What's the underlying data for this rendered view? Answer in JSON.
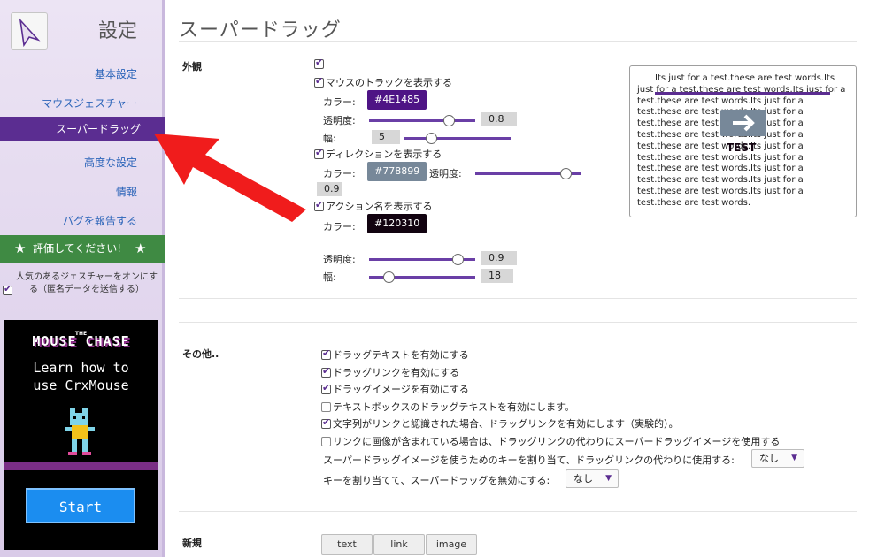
{
  "sidebar": {
    "title": "設定",
    "nav": [
      {
        "label": "基本設定"
      },
      {
        "label": "マウスジェスチャー"
      },
      {
        "label": "スーパードラッグ",
        "active": true
      },
      {
        "label": "高度な設定"
      },
      {
        "label": "情報"
      },
      {
        "label": "バグを報告する"
      }
    ],
    "rate_label": "評価してください!",
    "stats_label": "人気のあるジェスチャーをオンにする（匿名データを送信する）",
    "ad": {
      "the": "THE",
      "title": "MOUSE CHASE",
      "tagline_1": "Learn how to",
      "tagline_2": "use CrxMouse",
      "start": "Start"
    }
  },
  "main": {
    "title": "スーパードラッグ",
    "appearance": {
      "label": "外観",
      "show_track": "マウスのトラックを表示する",
      "color_label": "カラー:",
      "track_color": "#4E1485",
      "opacity_label": "透明度:",
      "track_opacity": "0.8",
      "width_label": "幅:",
      "track_width": "5",
      "show_direction": "ディレクションを表示する",
      "direction_color": "#778899",
      "direction_opacity": "0.9",
      "show_action": "アクション名を表示する",
      "action_color": "#120310",
      "action_opacity": "0.9",
      "action_width": "18"
    },
    "preview": {
      "text": "Its just for a test.these are test words.Its just for a test.these are test words.Its just for a test.these are test words.Its just for a test.these are test words.Its just for a test.these are test words.Its just for a test.these are test words.Its just for a test.these are test words.Its just for a test.these are test words.Its just for a test.these are test words.Its just for a test.these are test words.Its just for a test.these are test words.Its just for a test.these are test words.",
      "action_label": "TEST"
    },
    "other": {
      "label": "その他..",
      "options": [
        {
          "label": "ドラッグテキストを有効にする",
          "checked": true
        },
        {
          "label": "ドラッグリンクを有効にする",
          "checked": true
        },
        {
          "label": "ドラッグイメージを有効にする",
          "checked": true
        },
        {
          "label": "テキストボックスのドラッグテキストを有効にします。",
          "checked": false
        },
        {
          "label": "文字列がリンクと認識された場合、ドラッグリンクを有効にします（実験的）。",
          "checked": true
        },
        {
          "label": "リンクに画像が含まれている場合は、ドラッグリンクの代わりにスーパードラッグイメージを使用する",
          "checked": false
        }
      ],
      "key_image_label": "スーパードラッグイメージを使うためのキーを割り当て、ドラッグリンクの代わりに使用する:",
      "key_image_value": "なし",
      "key_disable_label": "キーを割り当てて、スーパードラッグを無効にする:",
      "key_disable_value": "なし"
    },
    "new": {
      "label": "新規",
      "buttons": [
        "text",
        "link",
        "image"
      ]
    }
  },
  "colors": {
    "accent": "#5b2d91",
    "rate_green": "#3f8a43",
    "annotation_arrow": "#f01c1c"
  }
}
